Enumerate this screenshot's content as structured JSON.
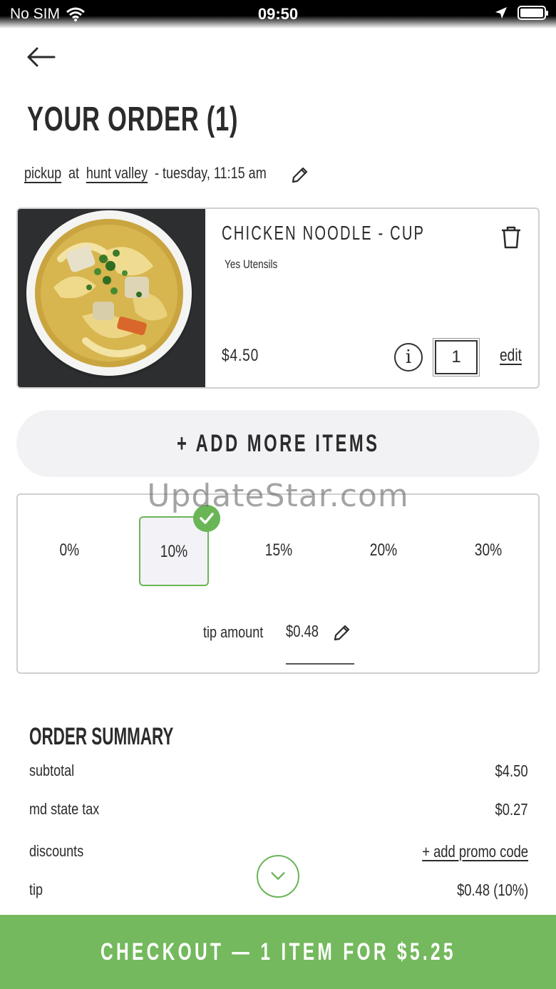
{
  "status_bar": {
    "carrier": "No SIM",
    "time": "09:50"
  },
  "header": {
    "title": "YOUR ORDER (1)"
  },
  "order_info": {
    "mode": "pickup",
    "at": "at",
    "location": "hunt valley",
    "datetime": "- tuesday, 11:15 am"
  },
  "item": {
    "name": "CHICKEN NOODLE - CUP",
    "modifier": "Yes Utensils",
    "price": "$4.50",
    "quantity": "1",
    "info_symbol": "i",
    "edit_label": "edit"
  },
  "add_more_label": "+ ADD MORE ITEMS",
  "watermark": "UpdateStar.com",
  "tip": {
    "options": [
      "0%",
      "10%",
      "15%",
      "20%",
      "30%"
    ],
    "selected": "10%",
    "amount_label": "tip amount",
    "amount_value": "$0.48"
  },
  "summary": {
    "title": "ORDER SUMMARY",
    "rows": [
      {
        "label": "subtotal",
        "value": "$4.50"
      },
      {
        "label": "md state tax",
        "value": "$0.27"
      },
      {
        "label": "discounts",
        "value": "+ add promo code"
      },
      {
        "label": "tip",
        "value": "$0.48 (10%)"
      }
    ]
  },
  "checkout_label": "CHECKOUT — 1 ITEM FOR $5.25",
  "colors": {
    "accent_green": "#74b95d",
    "selected_border": "#6ab556"
  }
}
